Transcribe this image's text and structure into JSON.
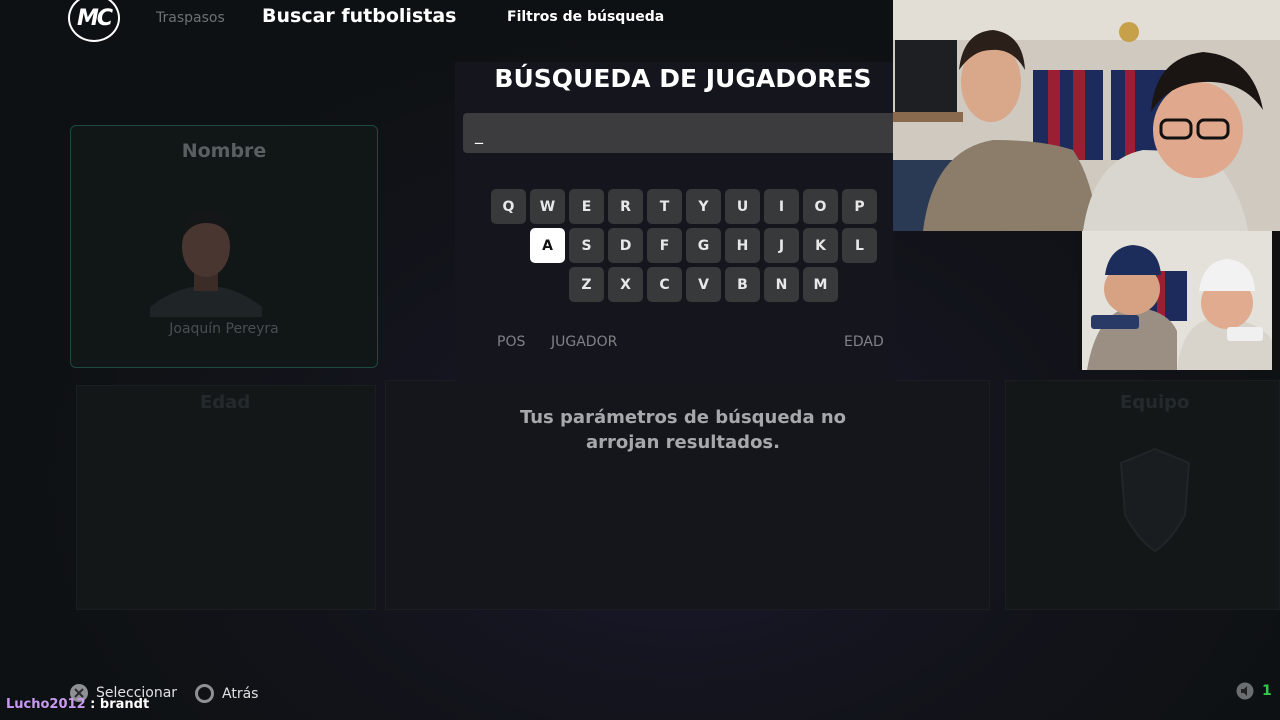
{
  "header": {
    "logo_text": "MC",
    "nav_traspasos": "Traspasos",
    "nav_buscar": "Buscar futbolistas",
    "nav_filtros": "Filtros de búsqueda"
  },
  "background": {
    "nombre_card_title": "Nombre",
    "player_name": "Joaquín Pereyra",
    "edad_label": "Edad",
    "equipo_label": "Equipo"
  },
  "modal": {
    "title": "BÚSQUEDA DE JUGADORES",
    "input_value": "_",
    "keyboard_rows": [
      [
        "Q",
        "W",
        "E",
        "R",
        "T",
        "Y",
        "U",
        "I",
        "O",
        "P"
      ],
      [
        "A",
        "S",
        "D",
        "F",
        "G",
        "H",
        "J",
        "K",
        "L"
      ],
      [
        "Z",
        "X",
        "C",
        "V",
        "B",
        "N",
        "M"
      ]
    ],
    "active_key": "A",
    "col_pos": "POS",
    "col_jugador": "JUGADOR",
    "col_edad": "EDAD",
    "no_results": "Tus parámetros de búsqueda no arrojan resultados."
  },
  "footer": {
    "select_label": "Seleccionar",
    "back_label": "Atrás",
    "chat_user": "Lucho2012",
    "chat_sep": " : ",
    "chat_message": "brandt",
    "corner_count": "1"
  },
  "icons": {
    "select": "cross-button-icon",
    "back": "circle-button-icon",
    "speaker": "speaker-icon"
  },
  "colors": {
    "accent_green": "#2ec94a",
    "chat_user": "#c99bf0",
    "active_key_bg": "#ffffff"
  }
}
